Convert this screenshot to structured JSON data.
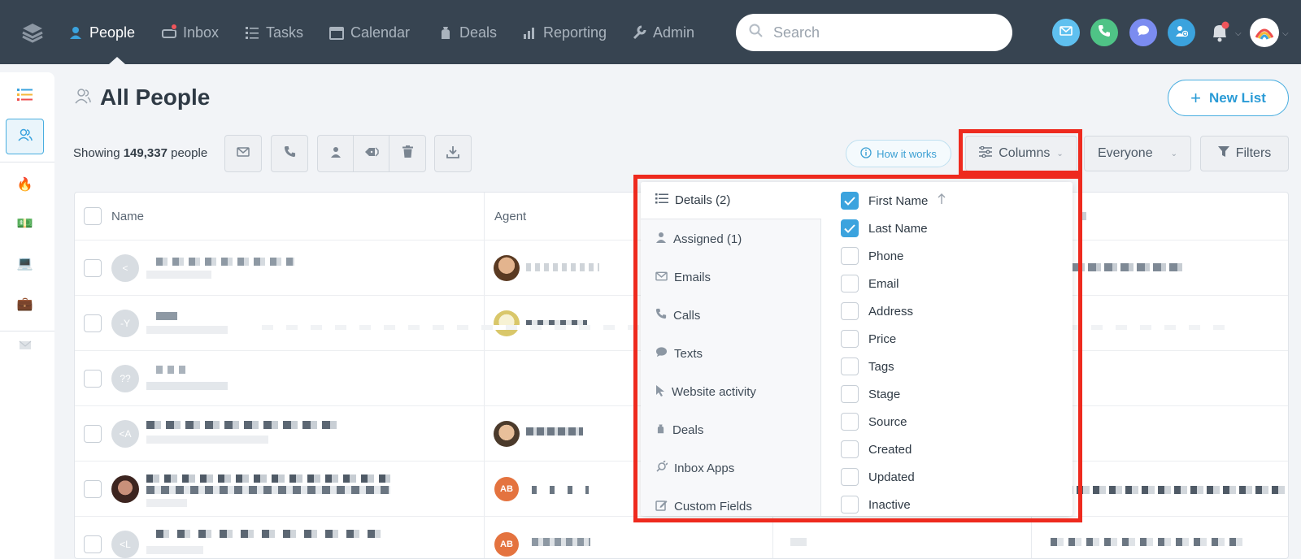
{
  "nav": {
    "items": [
      {
        "label": "People",
        "icon": "person-icon",
        "active": true
      },
      {
        "label": "Inbox",
        "icon": "inbox-icon",
        "active": false
      },
      {
        "label": "Tasks",
        "icon": "list-icon",
        "active": false
      },
      {
        "label": "Calendar",
        "icon": "calendar-icon",
        "active": false
      },
      {
        "label": "Deals",
        "icon": "money-bag-icon",
        "active": false
      },
      {
        "label": "Reporting",
        "icon": "chart-icon",
        "active": false
      },
      {
        "label": "Admin",
        "icon": "wrench-icon",
        "active": false
      }
    ],
    "search_placeholder": "Search"
  },
  "page": {
    "title": "All People",
    "new_list_label": "New List",
    "showing_prefix": "Showing",
    "showing_count": "149,337",
    "showing_suffix": "people",
    "how_it_works": "How it works",
    "columns_label": "Columns",
    "everyone_label": "Everyone",
    "filters_label": "Filters"
  },
  "table": {
    "headers": [
      "Name",
      "Agent"
    ],
    "rows": [
      {
        "initials": "<"
      },
      {
        "initials": "-Y"
      },
      {
        "initials": "??"
      },
      {
        "initials": "<A"
      },
      {
        "initials": ""
      },
      {
        "initials": "<L"
      }
    ],
    "agent_initials": "AB"
  },
  "columns_dropdown": {
    "categories": [
      {
        "label": "Details (2)",
        "icon": "list-icon"
      },
      {
        "label": "Assigned (1)",
        "icon": "person-icon"
      },
      {
        "label": "Emails",
        "icon": "envelope-icon"
      },
      {
        "label": "Calls",
        "icon": "phone-icon"
      },
      {
        "label": "Texts",
        "icon": "chat-bubble-icon"
      },
      {
        "label": "Website activity",
        "icon": "cursor-icon"
      },
      {
        "label": "Deals",
        "icon": "money-bag-icon"
      },
      {
        "label": "Inbox Apps",
        "icon": "plug-icon"
      },
      {
        "label": "Custom Fields",
        "icon": "edit-icon"
      }
    ],
    "options": [
      {
        "label": "First Name",
        "checked": true,
        "sorted": true
      },
      {
        "label": "Last Name",
        "checked": true
      },
      {
        "label": "Phone",
        "checked": false
      },
      {
        "label": "Email",
        "checked": false
      },
      {
        "label": "Address",
        "checked": false
      },
      {
        "label": "Price",
        "checked": false
      },
      {
        "label": "Tags",
        "checked": false
      },
      {
        "label": "Stage",
        "checked": false
      },
      {
        "label": "Source",
        "checked": false
      },
      {
        "label": "Created",
        "checked": false
      },
      {
        "label": "Updated",
        "checked": false
      },
      {
        "label": "Inactive",
        "checked": false
      }
    ]
  },
  "colors": {
    "nav_bg": "#374451",
    "accent": "#3ba3de",
    "highlight": "#ee2a1e"
  }
}
